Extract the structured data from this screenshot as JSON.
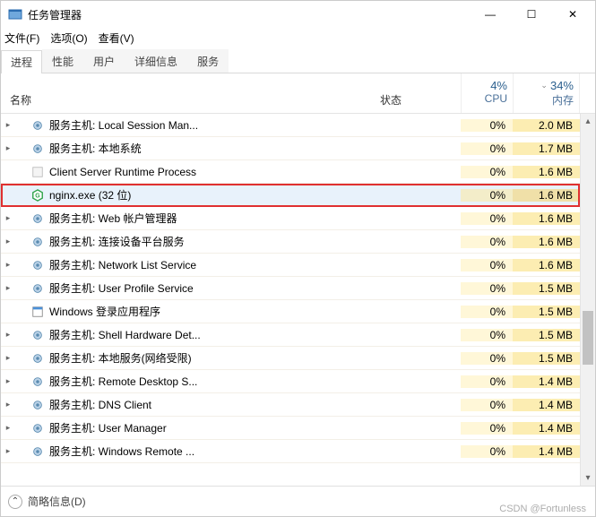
{
  "window": {
    "title": "任务管理器",
    "minimize": "—",
    "maximize": "☐",
    "close": "✕"
  },
  "menu": {
    "file": "文件(F)",
    "options": "选项(O)",
    "view": "查看(V)"
  },
  "tabs": {
    "processes": "进程",
    "performance": "性能",
    "users": "用户",
    "details": "详细信息",
    "services": "服务"
  },
  "columns": {
    "name": "名称",
    "status": "状态",
    "cpu_percent": "4%",
    "cpu_label": "CPU",
    "mem_percent": "34%",
    "mem_label": "内存"
  },
  "rows": [
    {
      "exp": true,
      "icon": "gear",
      "label": "服务主机: Local Session Man...",
      "cpu": "0%",
      "mem": "2.0 MB",
      "hl": false
    },
    {
      "exp": true,
      "icon": "gear",
      "label": "服务主机: 本地系统",
      "cpu": "0%",
      "mem": "1.7 MB",
      "hl": false
    },
    {
      "exp": false,
      "icon": "blank",
      "label": "Client Server Runtime Process",
      "cpu": "0%",
      "mem": "1.6 MB",
      "hl": false
    },
    {
      "exp": false,
      "icon": "nginx",
      "label": "nginx.exe (32 位)",
      "cpu": "0%",
      "mem": "1.6 MB",
      "hl": true
    },
    {
      "exp": true,
      "icon": "gear",
      "label": "服务主机: Web 帐户管理器",
      "cpu": "0%",
      "mem": "1.6 MB",
      "hl": false
    },
    {
      "exp": true,
      "icon": "gear",
      "label": "服务主机: 连接设备平台服务",
      "cpu": "0%",
      "mem": "1.6 MB",
      "hl": false
    },
    {
      "exp": true,
      "icon": "gear",
      "label": "服务主机: Network List Service",
      "cpu": "0%",
      "mem": "1.6 MB",
      "hl": false
    },
    {
      "exp": true,
      "icon": "gear",
      "label": "服务主机: User Profile Service",
      "cpu": "0%",
      "mem": "1.5 MB",
      "hl": false
    },
    {
      "exp": false,
      "icon": "app",
      "label": "Windows 登录应用程序",
      "cpu": "0%",
      "mem": "1.5 MB",
      "hl": false
    },
    {
      "exp": true,
      "icon": "gear",
      "label": "服务主机: Shell Hardware Det...",
      "cpu": "0%",
      "mem": "1.5 MB",
      "hl": false
    },
    {
      "exp": true,
      "icon": "gear",
      "label": "服务主机: 本地服务(网络受限)",
      "cpu": "0%",
      "mem": "1.5 MB",
      "hl": false
    },
    {
      "exp": true,
      "icon": "gear",
      "label": "服务主机: Remote Desktop S...",
      "cpu": "0%",
      "mem": "1.4 MB",
      "hl": false
    },
    {
      "exp": true,
      "icon": "gear",
      "label": "服务主机: DNS Client",
      "cpu": "0%",
      "mem": "1.4 MB",
      "hl": false
    },
    {
      "exp": true,
      "icon": "gear",
      "label": "服务主机: User Manager",
      "cpu": "0%",
      "mem": "1.4 MB",
      "hl": false
    },
    {
      "exp": true,
      "icon": "gear",
      "label": "服务主机: Windows Remote ...",
      "cpu": "0%",
      "mem": "1.4 MB",
      "hl": false
    }
  ],
  "footer": {
    "fewer": "简略信息(D)"
  },
  "watermark": "CSDN @Fortunless"
}
